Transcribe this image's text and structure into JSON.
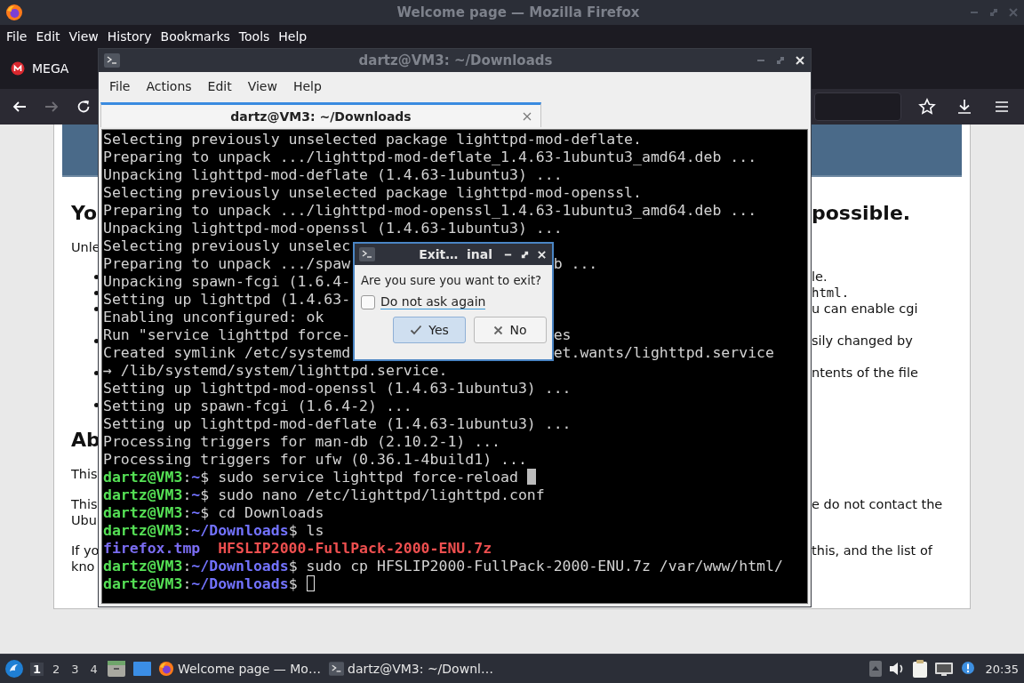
{
  "firefox": {
    "title": "Welcome page — Mozilla Firefox",
    "menu": [
      "File",
      "Edit",
      "View",
      "History",
      "Bookmarks",
      "Tools",
      "Help"
    ],
    "tabs": [
      {
        "label": "MEGA",
        "selected": false
      }
    ],
    "nav_buttons": [
      {
        "kind": "back",
        "disabled": false
      },
      {
        "kind": "forward",
        "disabled": true
      },
      {
        "kind": "reload",
        "disabled": false
      }
    ],
    "page": {
      "blocks": [
        {
          "kind": "heading",
          "left": "Yo",
          "right": "possible."
        },
        {
          "kind": "paragraph",
          "left": [
            "Unle"
          ]
        },
        {
          "kind": "list",
          "items": [
            {
              "right": "le.",
              "code": false,
              "wrapped": false
            },
            {
              "right": "html.",
              "code": true,
              "wrapped": false
            },
            {
              "right": "u can enable cgi",
              "code": false,
              "wrapped": true
            },
            {
              "right": "sily changed by",
              "code": false,
              "wrapped": true
            },
            {
              "right": "ntents of the file",
              "code": false,
              "wrapped": true
            },
            {
              "wrapped": false
            }
          ]
        },
        {
          "kind": "heading",
          "left": "Ab"
        },
        {
          "kind": "paragraph",
          "left": [
            "This"
          ]
        },
        {
          "kind": "paragraph",
          "left": [
            "This",
            "Ubu"
          ],
          "right": [
            "e do not contact the"
          ]
        },
        {
          "kind": "paragraph",
          "left": [
            "If yo",
            "kno"
          ],
          "right": [
            "this, and the list of"
          ]
        }
      ]
    }
  },
  "terminal": {
    "title": "dartz@VM3: ~/Downloads",
    "menu": [
      "File",
      "Actions",
      "Edit",
      "View",
      "Help"
    ],
    "tabs": [
      {
        "label": "dartz@VM3: ~/Downloads",
        "selected": true
      }
    ],
    "lines": [
      {
        "parts": [
          {
            "kind": "plain",
            "text": "Selecting previously unselected package lighttpd-mod-deflate."
          }
        ]
      },
      {
        "parts": [
          {
            "kind": "plain",
            "text": "Preparing to unpack .../lighttpd-mod-deflate_1.4.63-1ubuntu3_amd64.deb ..."
          }
        ]
      },
      {
        "parts": [
          {
            "kind": "plain",
            "text": "Unpacking lighttpd-mod-deflate (1.4.63-1ubuntu3) ..."
          }
        ]
      },
      {
        "parts": [
          {
            "kind": "plain",
            "text": "Selecting previously unselected package lighttpd-mod-openssl."
          }
        ]
      },
      {
        "parts": [
          {
            "kind": "plain",
            "text": "Preparing to unpack .../lighttpd-mod-openssl_1.4.63-1ubuntu3_amd64.deb ..."
          }
        ]
      },
      {
        "parts": [
          {
            "kind": "plain",
            "text": "Unpacking lighttpd-mod-openssl (1.4.63-1ubuntu3) ..."
          }
        ]
      },
      {
        "parts": [
          {
            "kind": "plain",
            "text": "Selecting previously unselec"
          }
        ]
      },
      {
        "parts": [
          {
            "kind": "plain",
            "text": "Preparing to unpack .../spaw"
          }
        ],
        "right": "b ..."
      },
      {
        "parts": [
          {
            "kind": "plain",
            "text": "Unpacking spawn-fcgi (1.6.4-"
          }
        ]
      },
      {
        "parts": [
          {
            "kind": "plain",
            "text": "Setting up lighttpd (1.4.63-"
          }
        ]
      },
      {
        "parts": [
          {
            "kind": "plain",
            "text": "Enabling unconfigured: ok"
          }
        ]
      },
      {
        "parts": [
          {
            "kind": "plain",
            "text": "Run \"service lighttpd force-"
          }
        ],
        "right": "es"
      },
      {
        "parts": [
          {
            "kind": "plain",
            "text": "Created symlink /etc/systemd"
          }
        ],
        "right": "et.wants/lighttpd.service"
      },
      {
        "parts": [
          {
            "kind": "plain",
            "text": "→ /lib/systemd/system/lighttpd.service."
          }
        ]
      },
      {
        "parts": [
          {
            "kind": "plain",
            "text": "Setting up lighttpd-mod-openssl (1.4.63-1ubuntu3) ..."
          }
        ]
      },
      {
        "parts": [
          {
            "kind": "plain",
            "text": "Setting up spawn-fcgi (1.6.4-2) ..."
          }
        ]
      },
      {
        "parts": [
          {
            "kind": "plain",
            "text": "Setting up lighttpd-mod-deflate (1.4.63-1ubuntu3) ..."
          }
        ]
      },
      {
        "parts": [
          {
            "kind": "plain",
            "text": "Processing triggers for man-db (2.10.2-1) ..."
          }
        ]
      },
      {
        "parts": [
          {
            "kind": "plain",
            "text": "Processing triggers for ufw (0.36.1-4build1) ..."
          }
        ]
      },
      {
        "parts": [
          {
            "kind": "user",
            "text": "dartz@VM3"
          },
          {
            "kind": "plain",
            "text": ":"
          },
          {
            "kind": "path",
            "text": "~"
          },
          {
            "kind": "plain",
            "text": "$ sudo service lighttpd force-reload "
          }
        ],
        "cursor": true,
        "cursor_filled": true
      },
      {
        "parts": [
          {
            "kind": "user",
            "text": "dartz@VM3"
          },
          {
            "kind": "plain",
            "text": ":"
          },
          {
            "kind": "path",
            "text": "~"
          },
          {
            "kind": "plain",
            "text": "$ sudo nano /etc/lighttpd/lighttpd.conf"
          }
        ]
      },
      {
        "parts": [
          {
            "kind": "user",
            "text": "dartz@VM3"
          },
          {
            "kind": "plain",
            "text": ":"
          },
          {
            "kind": "path",
            "text": "~"
          },
          {
            "kind": "plain",
            "text": "$ cd Downloads"
          }
        ]
      },
      {
        "parts": [
          {
            "kind": "user",
            "text": "dartz@VM3"
          },
          {
            "kind": "plain",
            "text": ":"
          },
          {
            "kind": "path",
            "text": "~/Downloads"
          },
          {
            "kind": "plain",
            "text": "$ ls"
          }
        ]
      },
      {
        "parts": [
          {
            "kind": "file",
            "text": "firefox.tmp"
          },
          {
            "kind": "archive",
            "text": "HFSLIP2000-FullPack-2000-ENU.7z"
          }
        ]
      },
      {
        "parts": [
          {
            "kind": "user",
            "text": "dartz@VM3"
          },
          {
            "kind": "plain",
            "text": ":"
          },
          {
            "kind": "path",
            "text": "~/Downloads"
          },
          {
            "kind": "plain",
            "text": "$ sudo cp HFSLIP2000-FullPack-2000-ENU.7z /var/www/html/"
          }
        ]
      },
      {
        "parts": [
          {
            "kind": "user",
            "text": "dartz@VM3"
          },
          {
            "kind": "plain",
            "text": ":"
          },
          {
            "kind": "path",
            "text": "~/Downloads"
          },
          {
            "kind": "plain",
            "text": "$ "
          }
        ],
        "cursor": true,
        "cursor_filled": false
      }
    ]
  },
  "dialog": {
    "title": "Exit…  inal",
    "message": "Are you sure you want to exit?",
    "checkbox": {
      "label": "Do not ask again",
      "checked": false
    },
    "buttons": [
      {
        "kind": "yes",
        "label": "Yes",
        "default": true
      },
      {
        "kind": "no",
        "label": "No",
        "default": false
      }
    ]
  },
  "taskbar": {
    "workspaces": [
      {
        "label": "1",
        "selected": true
      },
      {
        "label": "2",
        "selected": false
      },
      {
        "label": "3",
        "selected": false
      },
      {
        "label": "4",
        "selected": false
      }
    ],
    "tasks": [
      {
        "kind": "browser",
        "label": "Welcome page — Mo…"
      },
      {
        "kind": "terminal",
        "label": "dartz@VM3: ~/Downl…"
      }
    ],
    "clock": "20:35"
  }
}
